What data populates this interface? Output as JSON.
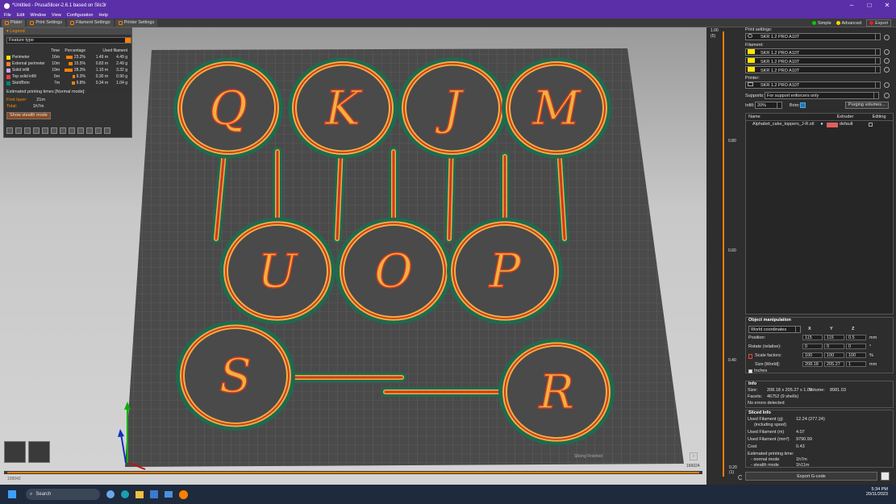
{
  "window": {
    "title": "*Untitled - PrusaSlicer-2.6.1 based on Slic3r"
  },
  "menu": [
    "File",
    "Edit",
    "Window",
    "View",
    "Configuration",
    "Help"
  ],
  "tabs": [
    "Plater",
    "Print Settings",
    "Filament Settings",
    "Printer Settings"
  ],
  "modes": {
    "simple": "Simple",
    "advanced": "Advanced",
    "expert": "Export",
    "colors": {
      "simple": "#00cc00",
      "advanced": "#ffd500",
      "expert": "#e02020"
    }
  },
  "legend": {
    "title": "Legend",
    "feature_select": "Feature type",
    "headers": [
      "Time",
      "Percentage",
      "Used filament"
    ],
    "rows": [
      {
        "name": "Perimeter",
        "time": "16m",
        "pct": "23.2%",
        "pct_value": 23.2,
        "len": "1.49 m",
        "g": "4.49 g",
        "color": "#ffe600"
      },
      {
        "name": "External perimeter",
        "time": "10m",
        "pct": "15.5%",
        "pct_value": 15.5,
        "len": "0.83 m",
        "g": "2.49 g",
        "color": "#ff7d38"
      },
      {
        "name": "Solid infill",
        "time": "19m",
        "pct": "28.3%",
        "pct_value": 28.3,
        "len": "1.10 m",
        "g": "3.32 g",
        "color": "#d3a0ff"
      },
      {
        "name": "Top solid infill",
        "time": "6m",
        "pct": "9.3%",
        "pct_value": 9.3,
        "len": "0.30 m",
        "g": "0.90 g",
        "color": "#f04040"
      },
      {
        "name": "Skirt/Brim",
        "time": "7m",
        "pct": "9.8%",
        "pct_value": 9.8,
        "len": "0.34 m",
        "g": "1.04 g",
        "color": "#00876e"
      }
    ],
    "est_title": "Estimated printing times [Normal mode]:",
    "first_layer_label": "First layer:",
    "first_layer": "21m",
    "total_label": "Total:",
    "total": "1h7m",
    "stealth_button": "Show stealth mode"
  },
  "viewport": {
    "status_text": "Slicing Finished",
    "h_slider_left": "109042",
    "h_slider_right": "166024",
    "layer_top": "1.00",
    "layer_top2": "(5)",
    "ticks": [
      "0.80",
      "0.60",
      "0.40"
    ],
    "layer_bottom": "0.20",
    "layer_bottom2": "(1)"
  },
  "right": {
    "print_settings_label": "Print settings:",
    "print_settings": "SKR 1.2 PRO A10T",
    "filament_label": "Filament:",
    "filaments": [
      "SKR 1.2 PRO A10T",
      "SKR 1.2 PRO A10T",
      "SKR 1.2 PRO A10T"
    ],
    "printer_label": "Printer:",
    "printer": "SKR 1.2 PRO A10T",
    "supports_label": "Supports:",
    "supports": "For support enforcers only",
    "infill_label": "Infill:",
    "infill": "20%",
    "brim_label": "Brim:",
    "purging_button": "Purging volumes...",
    "list_headers": [
      "Name",
      "Extruder",
      "Editing"
    ],
    "object_name": "Alphabet_cake_toppers_J-R.stl",
    "extruder": "default",
    "objman": {
      "title": "Object manipulation",
      "coords": "World coordinates",
      "x": "X",
      "y": "Y",
      "z": "Z",
      "position_label": "Position:",
      "position": [
        "115",
        "115",
        "0.5"
      ],
      "position_unit": "mm",
      "rotate_label": "Rotate (relative):",
      "rotate": [
        "0",
        "0",
        "0"
      ],
      "rotate_unit": "°",
      "scale_label": "Scale factors:",
      "scale": [
        "100",
        "100",
        "100"
      ],
      "scale_unit": "%",
      "size_label": "Size [World]:",
      "size": [
        "208.18",
        "205.27",
        "1"
      ],
      "size_unit": "mm",
      "inches_label": "Inches"
    },
    "info": {
      "title": "Info",
      "size_label": "Size:",
      "size": "208.18 x 205.27 x 1.00",
      "volume_label": "Volume:",
      "volume": "8981.03",
      "facets_label": "Facets:",
      "facets": "46752 (9 shells)",
      "errors": "No errors detected"
    },
    "sliced": {
      "title": "Sliced Info",
      "rows": [
        {
          "k": "Used Filament (g)",
          "k2": "(including spool)",
          "v": "12.24 (277.24)"
        },
        {
          "k": "Used Filament (m)",
          "v": "4.07"
        },
        {
          "k": "Used Filament (mm³)",
          "v": "9790.99"
        },
        {
          "k": "Cost",
          "v": "0.43"
        }
      ],
      "est": "Estimated printing time:",
      "normal_label": "- normal mode",
      "normal": "1h7m",
      "stealth_label": "- stealth mode",
      "stealth": "1h11m"
    },
    "export_button": "Export G-code"
  },
  "taskbar": {
    "search": "Search",
    "time": "5:34 PM",
    "date": "20/11/2023"
  },
  "letters": [
    "Q",
    "K",
    "J",
    "M",
    "U",
    "O",
    "P",
    "S",
    "R"
  ]
}
